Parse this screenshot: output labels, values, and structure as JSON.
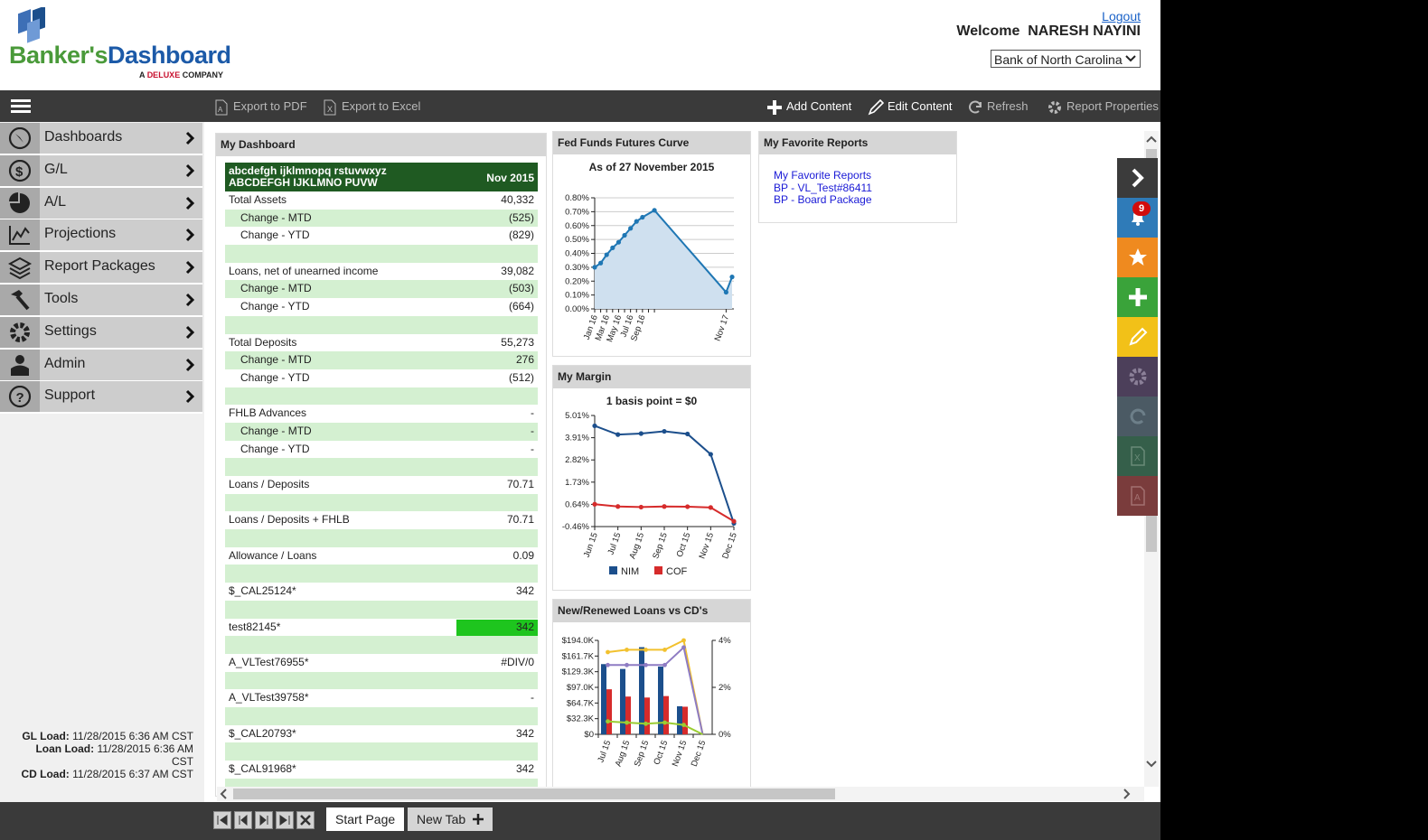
{
  "header": {
    "logo_part1": "Banker's",
    "logo_part2": "Dashboard",
    "logo_sub_a": "A",
    "logo_sub_brand": "DELUXE",
    "logo_sub_b": "COMPANY",
    "logout": "Logout",
    "welcome": "Welcome  NARESH NAYINI",
    "bank_select": "Bank of North Carolina"
  },
  "toolbar": {
    "export_pdf": "Export to PDF",
    "export_excel": "Export to Excel",
    "add_content": "Add Content",
    "edit_content": "Edit Content",
    "refresh": "Refresh",
    "report_properties": "Report Properties"
  },
  "sidebar": {
    "items": [
      {
        "label": "Dashboards",
        "icon": "compass-icon"
      },
      {
        "label": "G/L",
        "icon": "dollar-icon"
      },
      {
        "label": "A/L",
        "icon": "pie-icon"
      },
      {
        "label": "Projections",
        "icon": "line-chart-icon"
      },
      {
        "label": "Report Packages",
        "icon": "layers-icon"
      },
      {
        "label": "Tools",
        "icon": "hammer-icon"
      },
      {
        "label": "Settings",
        "icon": "gear-icon"
      },
      {
        "label": "Admin",
        "icon": "user-icon"
      },
      {
        "label": "Support",
        "icon": "question-icon"
      }
    ],
    "loads": {
      "gl_label": "GL Load:",
      "gl_value": "11/28/2015 6:36 AM CST",
      "loan_label": "Loan Load:",
      "loan_value": "11/28/2015 6:36 AM",
      "loan_value2": "CST",
      "cd_label": "CD Load:",
      "cd_value": "11/28/2015 6:37 AM CST"
    }
  },
  "my_dashboard": {
    "title": "My Dashboard",
    "head_line1": "abcdefgh ijklmnopq rstuvwxyz",
    "head_line2": "ABCDEFGH IJKLMNO PUVW",
    "head_period": "Nov 2015",
    "rows": [
      {
        "label": "Total Assets",
        "value": "40,332"
      },
      {
        "label": "Change - MTD",
        "value": "(525)"
      },
      {
        "label": "Change - YTD",
        "value": "(829)"
      },
      {
        "label": "",
        "value": ""
      },
      {
        "label": "Loans, net of unearned income",
        "value": "39,082"
      },
      {
        "label": "Change - MTD",
        "value": "(503)"
      },
      {
        "label": "Change - YTD",
        "value": "(664)"
      },
      {
        "label": "",
        "value": ""
      },
      {
        "label": "Total Deposits",
        "value": "55,273"
      },
      {
        "label": "Change - MTD",
        "value": "276"
      },
      {
        "label": "Change - YTD",
        "value": "(512)"
      },
      {
        "label": "",
        "value": ""
      },
      {
        "label": "FHLB Advances",
        "value": "-"
      },
      {
        "label": "Change - MTD",
        "value": "-"
      },
      {
        "label": "Change - YTD",
        "value": "-"
      },
      {
        "label": "",
        "value": ""
      },
      {
        "label": "Loans / Deposits",
        "value": "70.71"
      },
      {
        "label": "",
        "value": ""
      },
      {
        "label": "Loans / Deposits + FHLB",
        "value": "70.71"
      },
      {
        "label": "",
        "value": ""
      },
      {
        "label": "Allowance / Loans",
        "value": "0.09"
      },
      {
        "label": "",
        "value": ""
      },
      {
        "label": "$_CAL25124*",
        "value": "342"
      },
      {
        "label": "",
        "value": ""
      },
      {
        "label": "test82145*",
        "value": "342"
      },
      {
        "label": "",
        "value": ""
      },
      {
        "label": "A_VLTest76955*",
        "value": "#DIV/0"
      },
      {
        "label": "",
        "value": ""
      },
      {
        "label": "A_VLTest39758*",
        "value": "-"
      },
      {
        "label": "",
        "value": ""
      },
      {
        "label": "$_CAL20793*",
        "value": "342"
      },
      {
        "label": "",
        "value": ""
      },
      {
        "label": "$_CAL91968*",
        "value": "342"
      },
      {
        "label": "",
        "value": ""
      }
    ],
    "highlight_color": "#1ec51e"
  },
  "favorites": {
    "title": "My Favorite Reports",
    "links": [
      "My Favorite Reports",
      "BP - VL_Test#86411",
      "BP - Board Package"
    ]
  },
  "panels": {
    "fed_title": "Fed Funds Futures Curve",
    "margin_title": "My Margin",
    "loans_title": "New/Renewed Loans vs CD's"
  },
  "chart_data": [
    {
      "type": "area",
      "title": "As of 27 November 2015",
      "x_tick_labels": [
        "Jan 16",
        "Mar 16",
        "May 16",
        "Jul 16",
        "Sep 16",
        "Nov 17"
      ],
      "y_tick_labels": [
        "0.80%",
        "0.70%",
        "0.60%",
        "0.50%",
        "0.40%",
        "0.30%",
        "0.20%",
        "0.10%",
        "0.00%"
      ],
      "ylim": [
        0,
        0.8
      ],
      "series": [
        {
          "values": [
            0.3,
            0.33,
            0.39,
            0.44,
            0.48,
            0.53,
            0.58,
            0.63,
            0.66,
            0.71,
            0.12,
            0.23
          ]
        }
      ],
      "x_positions_month_index": [
        0,
        1,
        2,
        3,
        4,
        5,
        6,
        7,
        8,
        10,
        22,
        23
      ],
      "color": "#1f77b4",
      "fill": "#cfe0ef"
    },
    {
      "type": "line",
      "title": "1 basis point = $0",
      "categories": [
        "Jun 15",
        "Jul 15",
        "Aug 15",
        "Sep 15",
        "Oct 15",
        "Nov 15",
        "Dec 15"
      ],
      "y_tick_labels": [
        "5.01%",
        "3.91%",
        "2.82%",
        "1.73%",
        "0.64%",
        "-0.46%"
      ],
      "ylim": [
        -0.46,
        5.01
      ],
      "series": [
        {
          "name": "NIM",
          "color": "#1c4f8c",
          "values": [
            4.5,
            4.07,
            4.12,
            4.23,
            4.1,
            3.1,
            -0.3
          ]
        },
        {
          "name": "COF",
          "color": "#d62b2b",
          "values": [
            0.64,
            0.53,
            0.5,
            0.53,
            0.52,
            0.48,
            -0.2
          ]
        }
      ],
      "legend": "bottom"
    },
    {
      "type": "bar",
      "categories": [
        "Jul 15",
        "Aug 15",
        "Sep 15",
        "Oct 15",
        "Nov 15",
        "Dec 15"
      ],
      "y_tick_labels": [
        "$194.0K",
        "$161.7K",
        "$129.3K",
        "$97.0K",
        "$64.7K",
        "$32.3K",
        "$0"
      ],
      "y2_tick_labels": [
        "4%",
        "2%",
        "0%"
      ],
      "ylim": [
        0,
        194.0
      ],
      "y2lim": [
        0,
        4
      ],
      "series": [
        {
          "color": "#1c4f8c",
          "values": [
            145,
            135,
            180,
            140,
            58,
            0
          ]
        },
        {
          "color": "#d62b2b",
          "values": [
            93,
            78,
            76,
            79,
            57,
            0
          ]
        },
        {
          "color": "#f2c12e",
          "axis": "right",
          "values": [
            3.5,
            3.6,
            3.6,
            3.6,
            4.0,
            0
          ]
        },
        {
          "color": "#8e7cc3",
          "axis": "right",
          "values": [
            2.95,
            2.95,
            2.95,
            2.95,
            3.7,
            0
          ]
        },
        {
          "color": "#9acd32",
          "axis": "right",
          "values": [
            0.55,
            0.5,
            0.45,
            0.5,
            0.4,
            0.0
          ]
        }
      ]
    }
  ],
  "rail": {
    "badge": "9",
    "colors": [
      "#3b3b3b",
      "#2f7bb8",
      "#ef8a1f",
      "#3aa33a",
      "#f2c118",
      "#4c3f5a",
      "#4b5a64",
      "#355f4a",
      "#7a3c3c"
    ]
  },
  "bottom": {
    "tab1": "Start Page",
    "tab2": "New Tab"
  }
}
